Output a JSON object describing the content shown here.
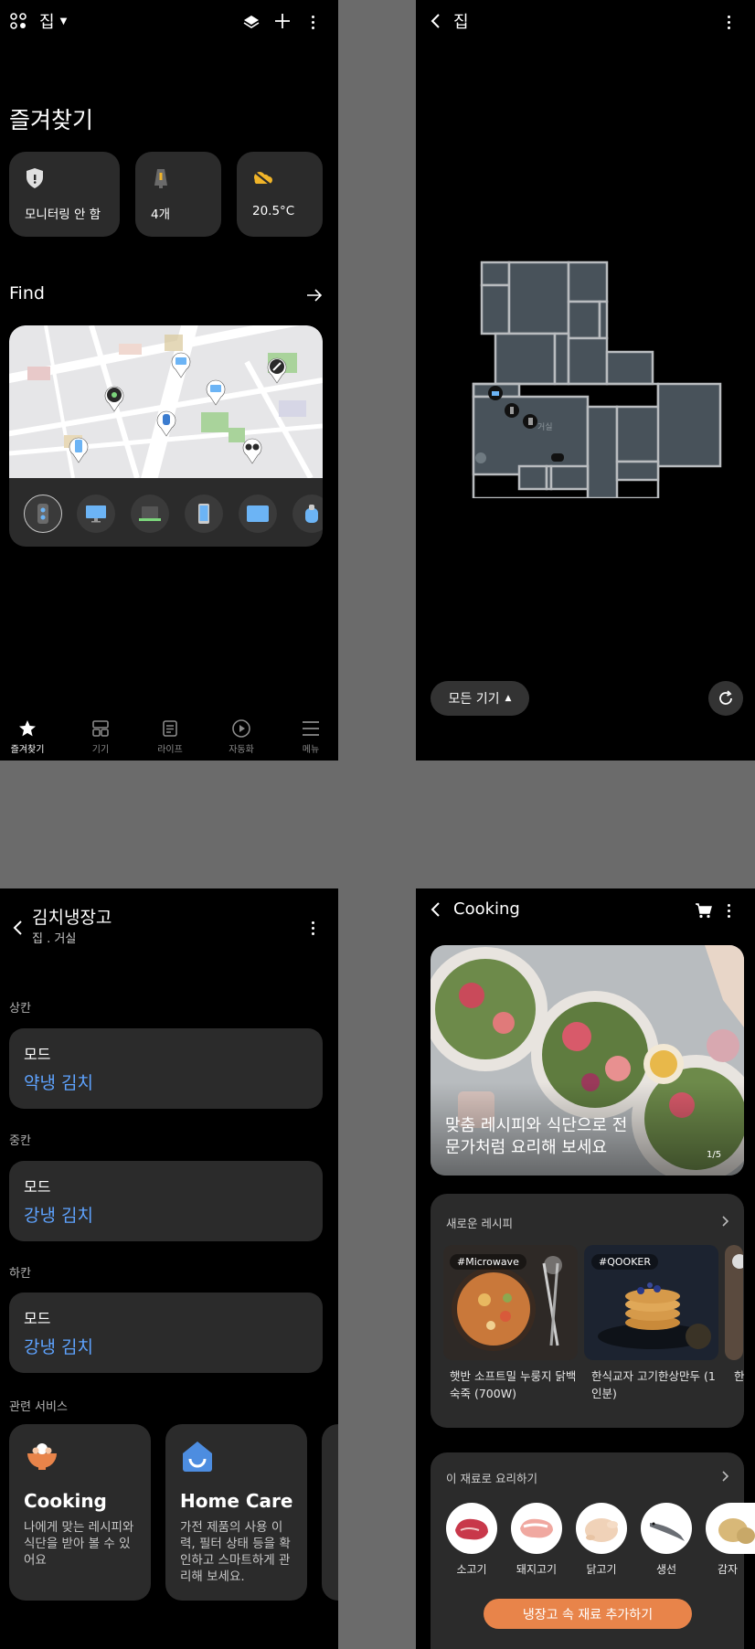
{
  "screen1": {
    "home_title": "집",
    "favorites_title": "즐겨찾기",
    "stats": [
      {
        "icon": "shield-icon",
        "label": "모니터링 안 함"
      },
      {
        "icon": "light-icon",
        "label": "4개"
      },
      {
        "icon": "weather-icon",
        "label": "20.5°C"
      }
    ],
    "find_title": "Find",
    "map_pins": [
      "pin-watch",
      "pin-monitor",
      "pin-pen",
      "pin-tag",
      "pin-monitor",
      "pin-phone",
      "pin-watch",
      "pin-earbuds"
    ],
    "device_icons": [
      "speaker-icon",
      "monitor-icon",
      "laptop-icon",
      "phone-icon",
      "tablet-icon",
      "tag-icon"
    ],
    "nav": [
      {
        "label": "즐겨찾기",
        "icon": "star-icon",
        "active": true
      },
      {
        "label": "기기",
        "icon": "devices-icon"
      },
      {
        "label": "라이프",
        "icon": "life-icon"
      },
      {
        "label": "자동화",
        "icon": "play-icon"
      },
      {
        "label": "메뉴",
        "icon": "menu-icon"
      }
    ]
  },
  "screen2": {
    "title": "집",
    "room_label": "거실",
    "all_devices_label": "모든 기기"
  },
  "screen3": {
    "title": "김치냉장고",
    "subtitle": "집 . 거실",
    "sections": [
      {
        "label": "상칸",
        "mode_label": "모드",
        "mode_value": "약냉 김치"
      },
      {
        "label": "중칸",
        "mode_label": "모드",
        "mode_value": "강냉 김치"
      },
      {
        "label": "하칸",
        "mode_label": "모드",
        "mode_value": "강냉 김치"
      }
    ],
    "related_label": "관련 서비스",
    "services": [
      {
        "title": "Cooking",
        "desc": "나에게 맞는 레시피와 식단을 받아 볼 수 있어요"
      },
      {
        "title": "Home Care",
        "desc": "가전 제품의 사용 이력, 필터 상태 등을 확인하고 스마트하게 관리해 보세요."
      }
    ]
  },
  "screen4": {
    "title": "Cooking",
    "hero_text": "맞춤 레시피와 식단으로 전문가처럼 요리해 보세요",
    "hero_counter": "1/5",
    "new_recipes_label": "새로운 레시피",
    "recipes": [
      {
        "tag": "#Microwave",
        "name": "햇반 소프트밀 누룽지 닭백숙죽 (700W)"
      },
      {
        "tag": "#QOOKER",
        "name": "한식교자 고기한상만두 (1인분)"
      },
      {
        "tag": "",
        "name": "한"
      }
    ],
    "ingredients_label": "이 재료로 요리하기",
    "ingredients": [
      "소고기",
      "돼지고기",
      "닭고기",
      "생선",
      "감자"
    ],
    "add_button": "냉장고 속 재료 추가하기"
  },
  "colors": {
    "background": "#000000",
    "card": "#2b2b2b",
    "accent_blue": "#5ea3ff",
    "accent_orange": "#e8844a"
  }
}
